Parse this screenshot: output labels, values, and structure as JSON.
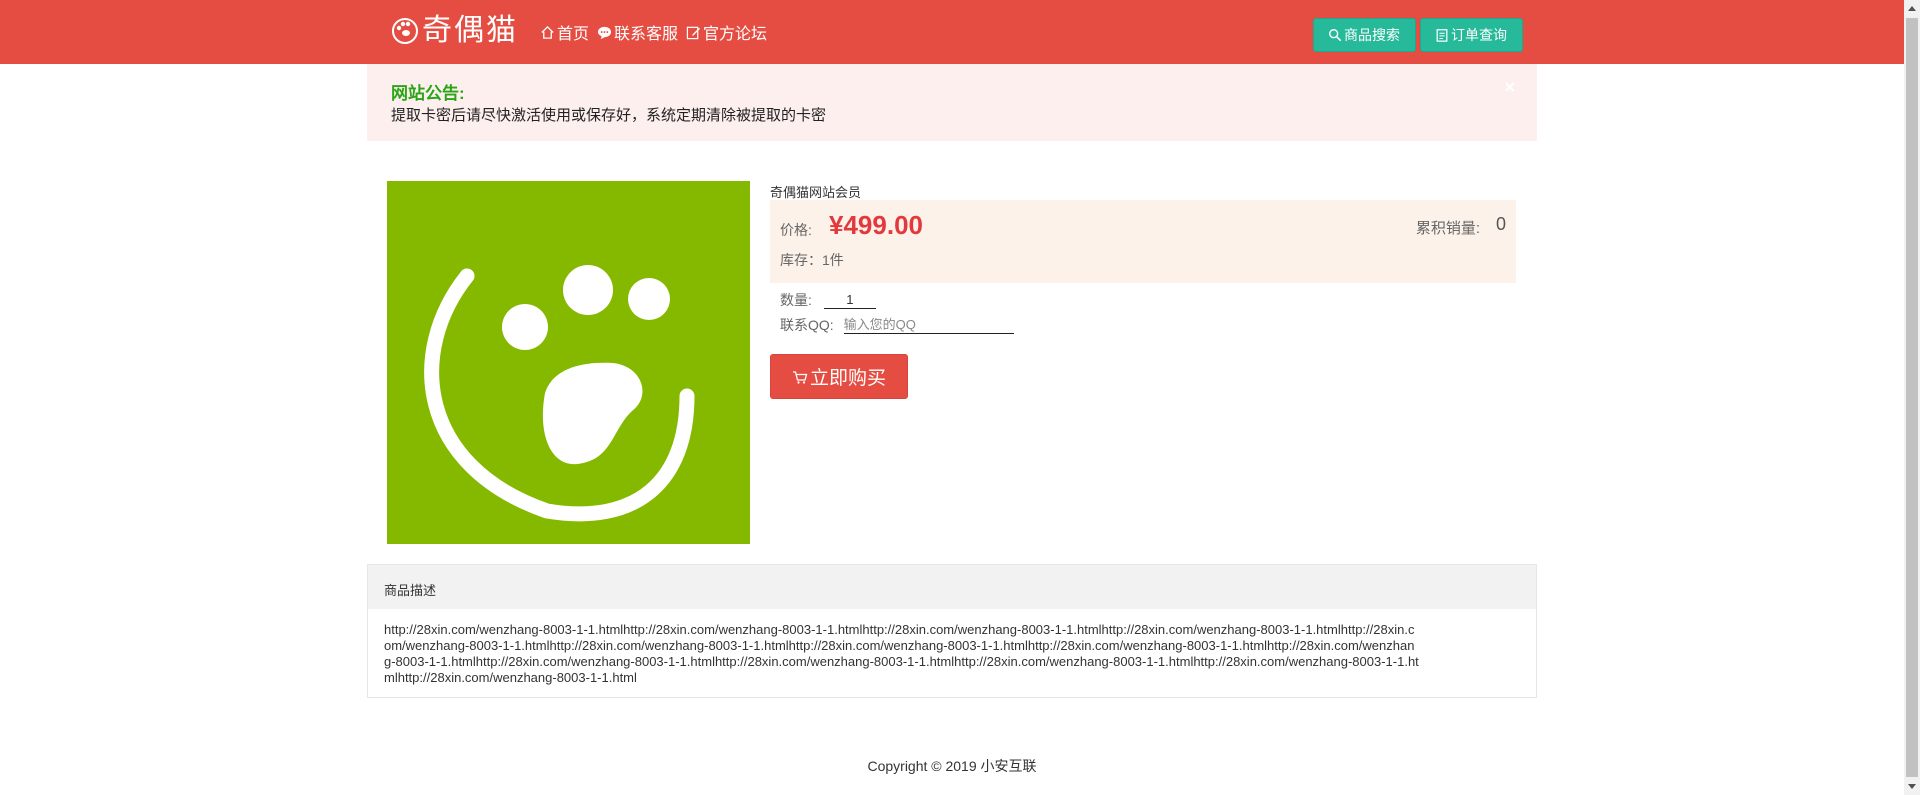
{
  "header": {
    "logo_text": "奇偶猫",
    "nav": [
      {
        "label": "首页",
        "icon": "home-icon"
      },
      {
        "label": "联系客服",
        "icon": "chat-icon"
      },
      {
        "label": "官方论坛",
        "icon": "edit-icon"
      }
    ],
    "buttons": [
      {
        "label": "商品搜索",
        "icon": "search-icon"
      },
      {
        "label": "订单查询",
        "icon": "clipboard-icon"
      }
    ],
    "colors": {
      "bar": "#e64d42",
      "button": "#26b99a"
    }
  },
  "notice": {
    "title": "网站公告:",
    "text": "提取卡密后请尽快激活使用或保存好，系统定期清除被提取的卡密",
    "close": "×"
  },
  "product": {
    "name": "奇偶猫网站会员",
    "price_label": "价格:",
    "price": "¥499.00",
    "sales_label": "累积销量:",
    "sales": "0",
    "stock": "库存：1件",
    "qty_label": "数量:",
    "qty_value": "1",
    "qq_label": "联系QQ:",
    "qq_placeholder": "输入您的QQ",
    "buy_label": "立即购买",
    "image_color": "#85b900"
  },
  "description": {
    "title": "商品描述",
    "body": "http://28xin.com/wenzhang-8003-1-1.htmlhttp://28xin.com/wenzhang-8003-1-1.htmlhttp://28xin.com/wenzhang-8003-1-1.htmlhttp://28xin.com/wenzhang-8003-1-1.htmlhttp://28xin.com/wenzhang-8003-1-1.htmlhttp://28xin.com/wenzhang-8003-1-1.htmlhttp://28xin.com/wenzhang-8003-1-1.htmlhttp://28xin.com/wenzhang-8003-1-1.htmlhttp://28xin.com/wenzhang-8003-1-1.htmlhttp://28xin.com/wenzhang-8003-1-1.htmlhttp://28xin.com/wenzhang-8003-1-1.htmlhttp://28xin.com/wenzhang-8003-1-1.htmlhttp://28xin.com/wenzhang-8003-1-1.htmlhttp://28xin.com/wenzhang-8003-1-1.html"
  },
  "footer": {
    "copyright": "Copyright © 2019 小安互联"
  }
}
